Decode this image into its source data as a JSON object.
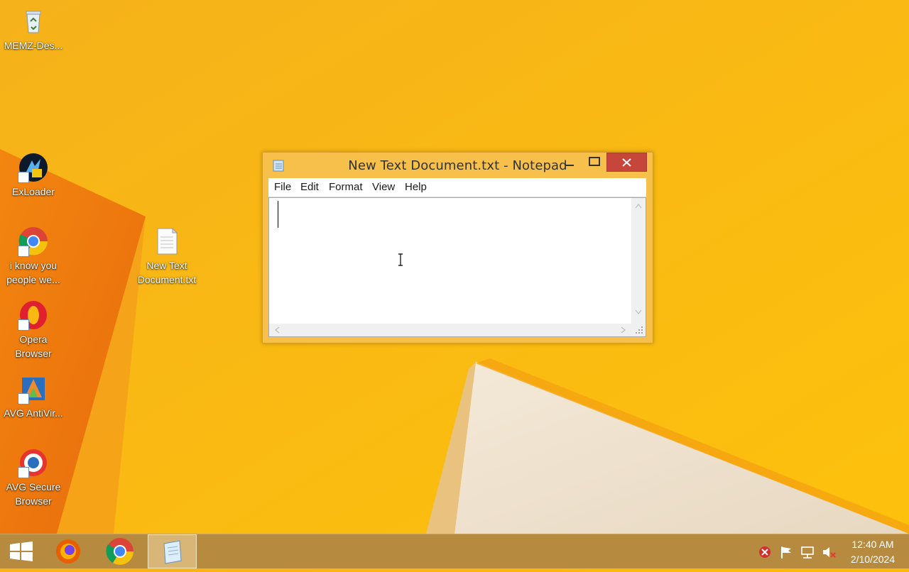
{
  "desktop": {
    "icons": [
      {
        "label": "MEMZ-Des...",
        "icon": "recycle-bin-icon"
      },
      {
        "label": "ExLoader",
        "icon": "exloader-icon"
      },
      {
        "label": "i know you people we...",
        "icon": "chrome-shortcut-icon"
      },
      {
        "label": "Opera Browser",
        "icon": "opera-icon"
      },
      {
        "label": "AVG AntiVir...",
        "icon": "avg-antivirus-icon"
      },
      {
        "label": "AVG Secure Browser",
        "icon": "avg-secure-browser-icon"
      },
      {
        "label": "New Text Document.txt",
        "icon": "text-file-icon"
      }
    ]
  },
  "notepad": {
    "title": "New Text Document.txt - Notepad",
    "menu": [
      "File",
      "Edit",
      "Format",
      "View",
      "Help"
    ],
    "content": ""
  },
  "taskbar": {
    "pinned": [
      "start-icon",
      "firefox-icon",
      "chrome-icon",
      "notepad-icon"
    ],
    "tray": [
      "avg-tray-icon",
      "action-center-flag-icon",
      "network-icon",
      "volume-muted-icon"
    ],
    "clock": {
      "time": "12:40 AM",
      "date": "2/10/2024"
    }
  },
  "colors": {
    "wallpaper": "#f9b714",
    "taskbar": "#b68a3f",
    "close_button": "#c7463b"
  }
}
